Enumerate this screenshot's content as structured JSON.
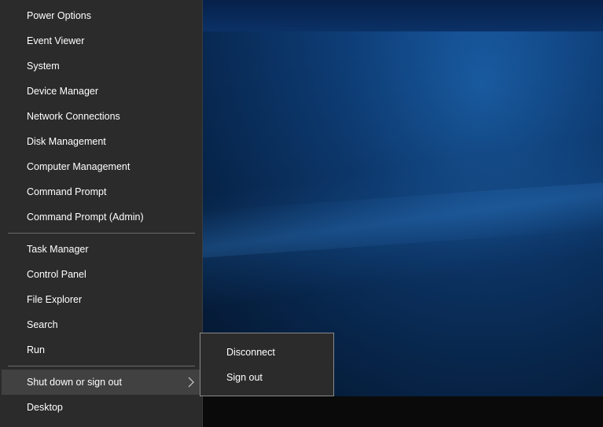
{
  "menu": {
    "group1": [
      "Power Options",
      "Event Viewer",
      "System",
      "Device Manager",
      "Network Connections",
      "Disk Management",
      "Computer Management",
      "Command Prompt",
      "Command Prompt (Admin)"
    ],
    "group2": [
      "Task Manager",
      "Control Panel",
      "File Explorer",
      "Search",
      "Run"
    ],
    "shutdown": "Shut down or sign out",
    "desktop": "Desktop"
  },
  "submenu": {
    "items": [
      "Disconnect",
      "Sign out"
    ]
  },
  "icons": {
    "submenu_arrow": "chevron-right-icon"
  },
  "colors": {
    "menu_bg": "#2b2b2b",
    "hover_bg": "#414141",
    "separator": "#6a6a6a",
    "desktop_blue": "#0e3f7a"
  }
}
